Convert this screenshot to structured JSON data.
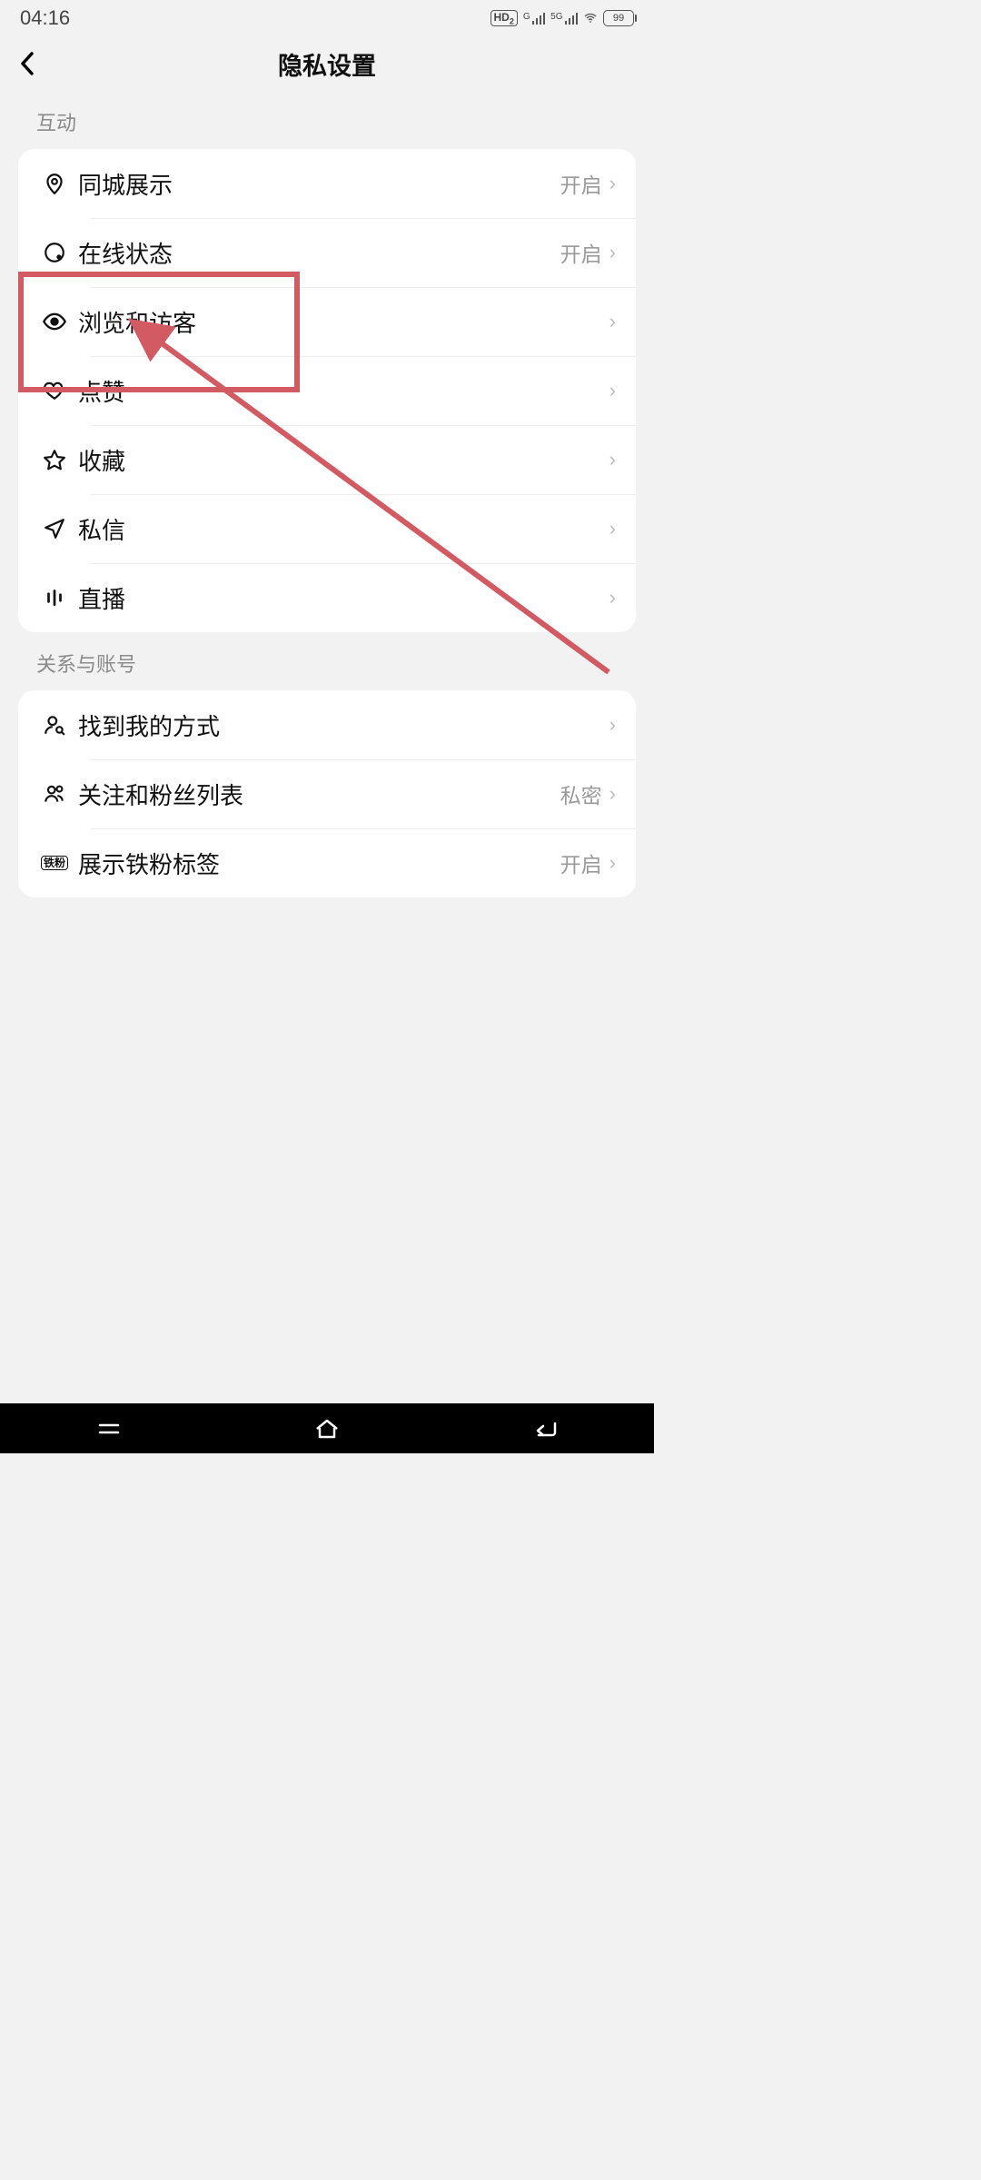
{
  "status": {
    "time": "04:16",
    "hd": "HD",
    "hd_sub": "2",
    "net1_label": "G",
    "net2_label": "5G",
    "battery": "99"
  },
  "header": {
    "title": "隐私设置"
  },
  "sections": [
    {
      "label": "互动",
      "rows": [
        {
          "icon": "pin",
          "label": "同城展示",
          "value": "开启"
        },
        {
          "icon": "online",
          "label": "在线状态",
          "value": "开启"
        },
        {
          "icon": "eye",
          "label": "浏览和访客",
          "value": ""
        },
        {
          "icon": "heart",
          "label": "点赞",
          "value": ""
        },
        {
          "icon": "star",
          "label": "收藏",
          "value": ""
        },
        {
          "icon": "send",
          "label": "私信",
          "value": ""
        },
        {
          "icon": "live",
          "label": "直播",
          "value": ""
        }
      ]
    },
    {
      "label": "关系与账号",
      "rows": [
        {
          "icon": "person",
          "label": "找到我的方式",
          "value": ""
        },
        {
          "icon": "people",
          "label": "关注和粉丝列表",
          "value": "私密"
        },
        {
          "icon": "badge",
          "label": "展示铁粉标签",
          "value": "开启"
        }
      ]
    }
  ],
  "badge_text": "铁粉",
  "annotation": {
    "highlighted_row_label": "浏览和访客"
  }
}
